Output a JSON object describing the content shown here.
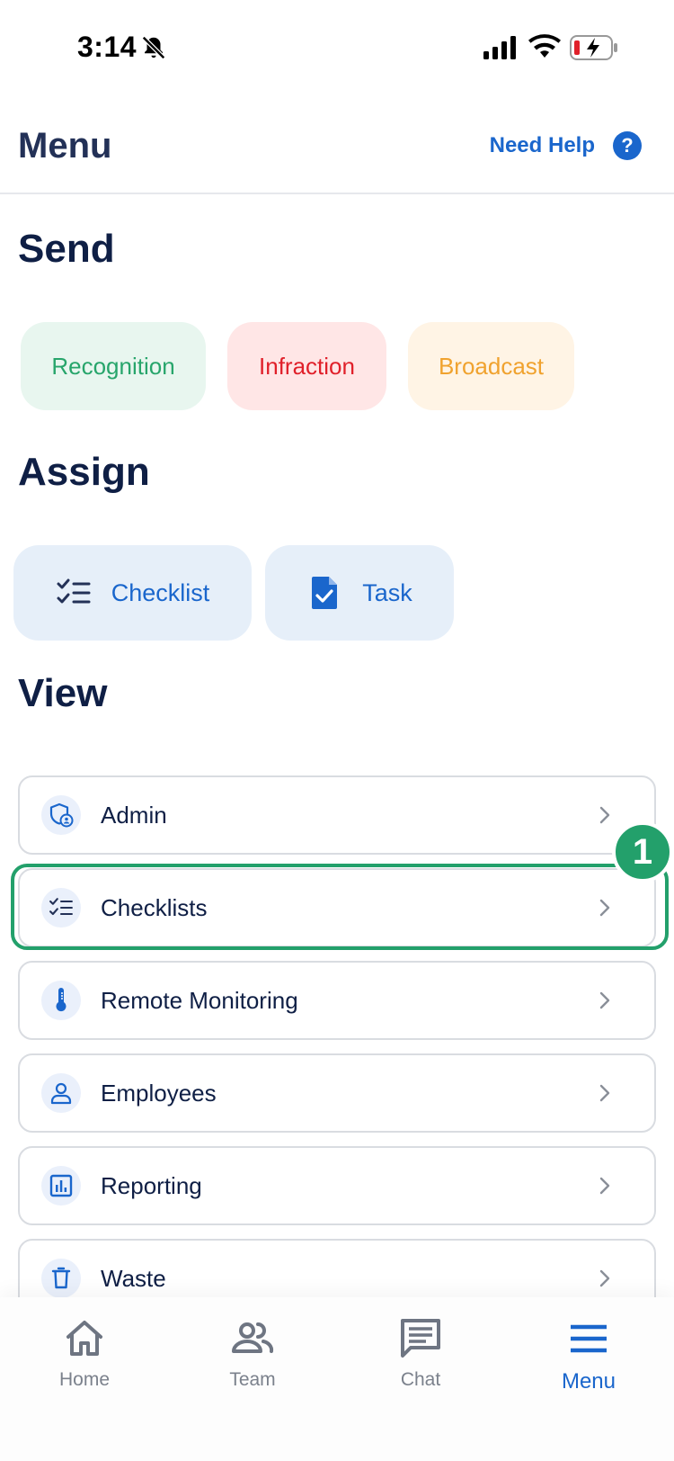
{
  "status_bar": {
    "time": "3:14"
  },
  "header": {
    "title": "Menu",
    "help_label": "Need Help",
    "help_glyph": "?"
  },
  "send": {
    "title": "Send",
    "buttons": [
      {
        "label": "Recognition",
        "color": "#27a56b"
      },
      {
        "label": "Infraction",
        "color": "#e0202a"
      },
      {
        "label": "Broadcast",
        "color": "#f0a22e"
      }
    ]
  },
  "assign": {
    "title": "Assign",
    "buttons": [
      {
        "label": "Checklist",
        "icon": "checklist-icon"
      },
      {
        "label": "Task",
        "icon": "task-document-icon"
      }
    ]
  },
  "view": {
    "title": "View",
    "items": [
      {
        "label": "Admin",
        "icon": "admin-shield-icon"
      },
      {
        "label": "Checklists",
        "icon": "checklist-icon"
      },
      {
        "label": "Remote Monitoring",
        "icon": "thermometer-icon"
      },
      {
        "label": "Employees",
        "icon": "person-icon"
      },
      {
        "label": "Reporting",
        "icon": "bar-chart-icon"
      },
      {
        "label": "Waste",
        "icon": "trash-icon"
      }
    ]
  },
  "annotation": {
    "step": "1",
    "color": "#23a06b"
  },
  "nav": {
    "items": [
      {
        "label": "Home",
        "icon": "home-icon"
      },
      {
        "label": "Team",
        "icon": "team-icon"
      },
      {
        "label": "Chat",
        "icon": "chat-icon"
      },
      {
        "label": "Menu",
        "icon": "menu-icon",
        "active": true
      }
    ]
  },
  "colors": {
    "accent": "#1a66cc",
    "text": "#0f1f45"
  }
}
